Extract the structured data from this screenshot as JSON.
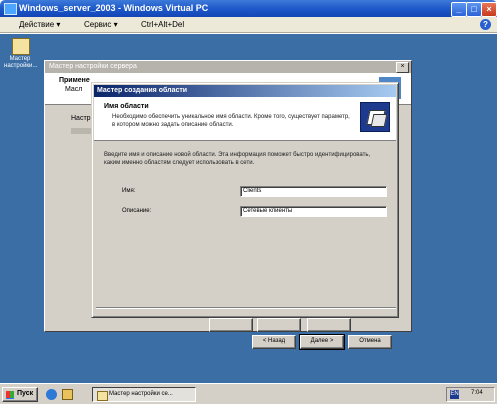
{
  "vpc": {
    "title": "Windows_server_2003 - Windows Virtual PC",
    "menu": {
      "action": "Действие ▾",
      "service": "Сервис ▾",
      "cad": "Ctrl+Alt+Del"
    },
    "help": "?"
  },
  "desktop": {
    "icon_label": "Мастер настройки..."
  },
  "bg_wizard": {
    "title": "Мастер настройки сервера",
    "frag1": "Примене",
    "frag2": "Масл",
    "frag3": "Настр"
  },
  "wizard": {
    "title": "Мастер создания области",
    "heading": "Имя области",
    "subtitle": "Необходимо обеспечить уникальное имя области. Кроме того, существует параметр, в котором можно задать описание области.",
    "intro": "Введите имя и описание новой области. Эта информация поможет быстро идентифицировать, каким именно областям следует использовать в сети.",
    "name_label": "Имя:",
    "name_value": "Clients",
    "desc_label": "Описание:",
    "desc_value": "Сетевые клиенты",
    "back": "< Назад",
    "next": "Далее >",
    "cancel": "Отмена"
  },
  "taskbar": {
    "start": "Пуск",
    "task": "Мастер настройки се...",
    "lang": "EN",
    "clock": "7:04"
  }
}
